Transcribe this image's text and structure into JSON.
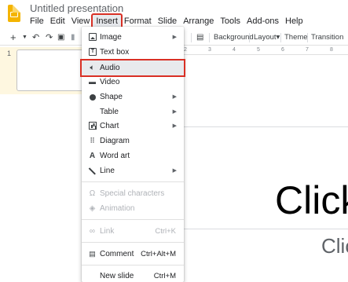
{
  "app": {
    "title": "Untitled presentation"
  },
  "menubar": [
    {
      "label": "File"
    },
    {
      "label": "Edit"
    },
    {
      "label": "View"
    },
    {
      "label": "Insert"
    },
    {
      "label": "Format"
    },
    {
      "label": "Slide"
    },
    {
      "label": "Arrange"
    },
    {
      "label": "Tools"
    },
    {
      "label": "Add-ons"
    },
    {
      "label": "Help"
    }
  ],
  "toolbar": {
    "add": "+",
    "background": "Background",
    "layout": "Layout▾",
    "theme": "Theme",
    "transition": "Transition"
  },
  "filmstrip": {
    "slide_number": "1"
  },
  "ruler": [
    "2",
    "3",
    "4",
    "5",
    "6",
    "7",
    "8"
  ],
  "slide": {
    "title_placeholder": "Click",
    "subtitle_placeholder": "Clic"
  },
  "insert_menu": {
    "items": [
      {
        "label": "Image",
        "icon": "image-icon",
        "submenu": true
      },
      {
        "label": "Text box",
        "icon": "text-box-icon"
      },
      {
        "label": "Audio",
        "icon": "audio-icon",
        "highlighted": true
      },
      {
        "label": "Video",
        "icon": "video-icon"
      },
      {
        "label": "Shape",
        "icon": "shape-icon",
        "submenu": true
      },
      {
        "label": "Table",
        "icon": "",
        "submenu": true
      },
      {
        "label": "Chart",
        "icon": "chart-icon",
        "submenu": true
      },
      {
        "label": "Diagram",
        "icon": "diagram-icon"
      },
      {
        "label": "Word art",
        "icon": "word-art-icon"
      },
      {
        "label": "Line",
        "icon": "line-icon",
        "submenu": true
      },
      {
        "label": "Special characters",
        "icon": "special-characters-icon",
        "disabled": true
      },
      {
        "label": "Animation",
        "icon": "animation-icon",
        "disabled": true
      },
      {
        "label": "Link",
        "icon": "link-icon",
        "disabled": true,
        "shortcut": "Ctrl+K"
      },
      {
        "label": "Comment",
        "icon": "comment-icon",
        "shortcut": "Ctrl+Alt+M"
      },
      {
        "label": "New slide",
        "icon": "",
        "shortcut": "Ctrl+M"
      }
    ]
  },
  "colors": {
    "highlight_outline": "#d93025",
    "filmstrip_bg": "#fef7e0",
    "app_icon": "#f4b400"
  }
}
